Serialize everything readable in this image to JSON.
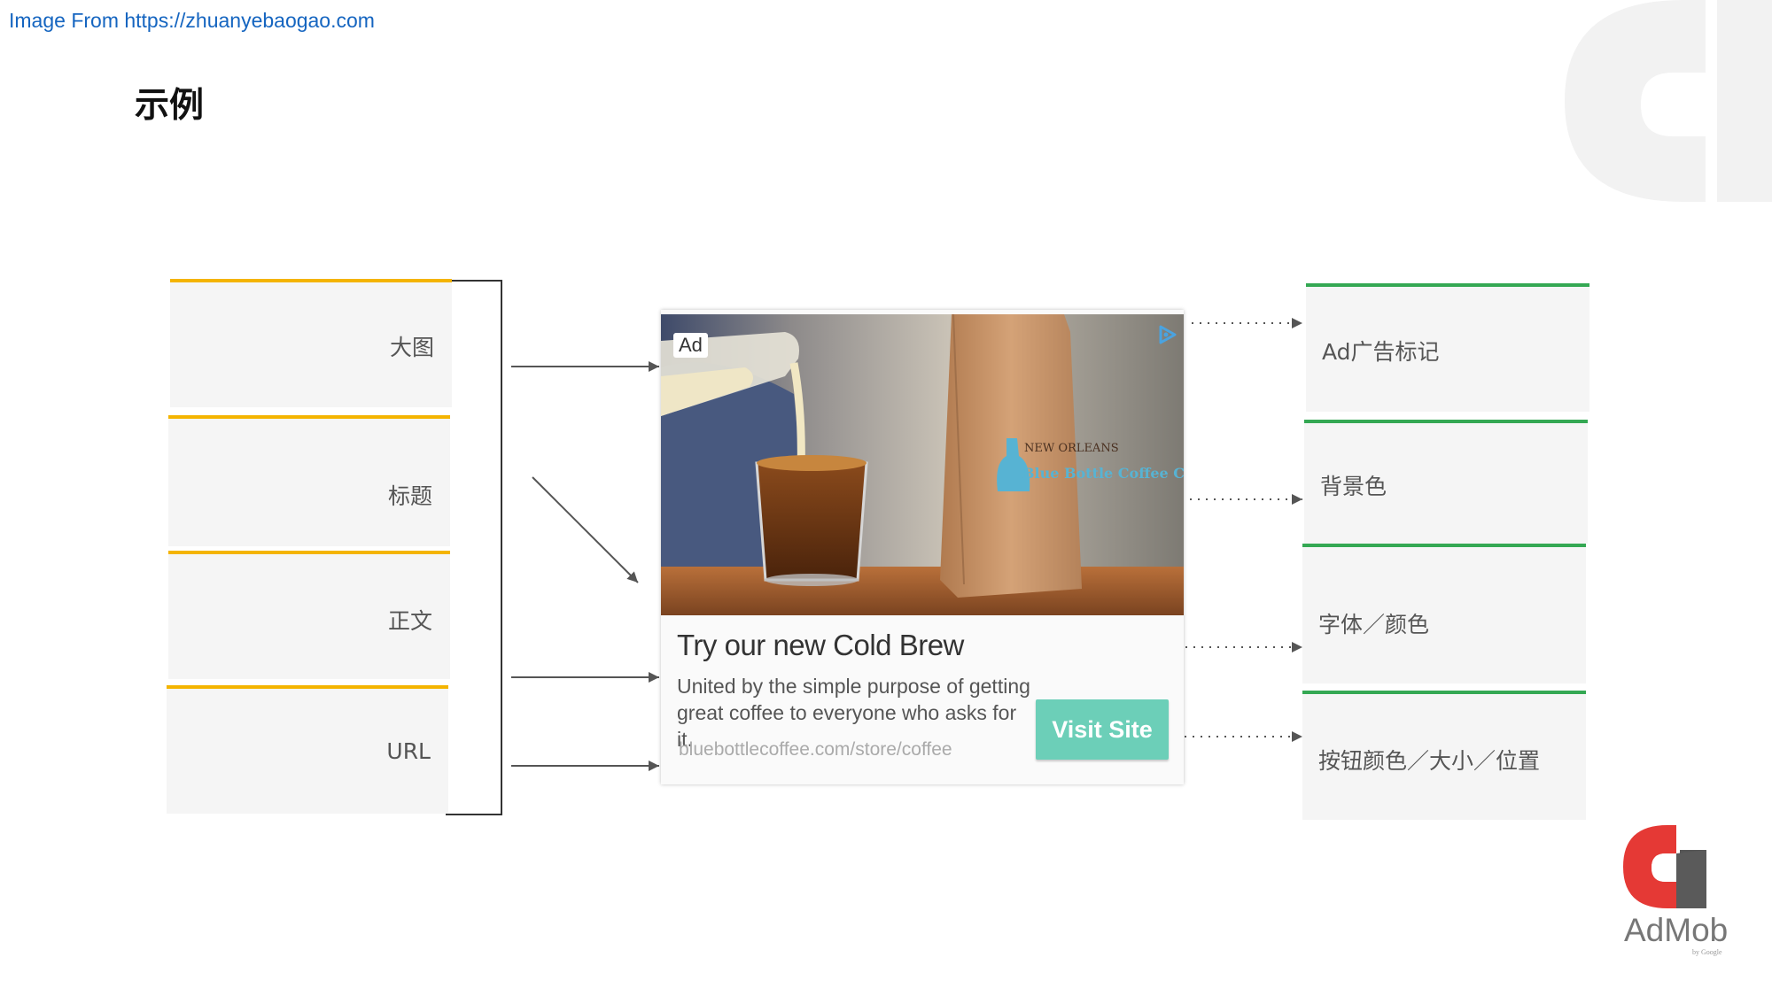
{
  "source": "Image From https://zhuanyebaogao.com",
  "title": "示例",
  "left_labels": [
    "大图",
    "标题",
    "正文",
    "URL"
  ],
  "right_labels": [
    "Ad广告标记",
    "背景色",
    "字体／颜色",
    "按钮颜色／大小／位置"
  ],
  "ad": {
    "badge": "Ad",
    "headline": "Try our new Cold Brew",
    "body": "United by the simple purpose of getting great coffee to everyone who asks for it.",
    "url": "bluebottlecoffee.com/store/coffee",
    "cta": "Visit Site",
    "bag_text_1": "NEW ORLEANS",
    "bag_text_2": "Blue Bottle Coffee Co"
  },
  "logo": {
    "name": "AdMob",
    "sub": "by Google"
  },
  "colors": {
    "left_accent": "#f4b400",
    "right_accent": "#34a853",
    "cta": "#6ccfb8",
    "link": "#1565c0"
  }
}
